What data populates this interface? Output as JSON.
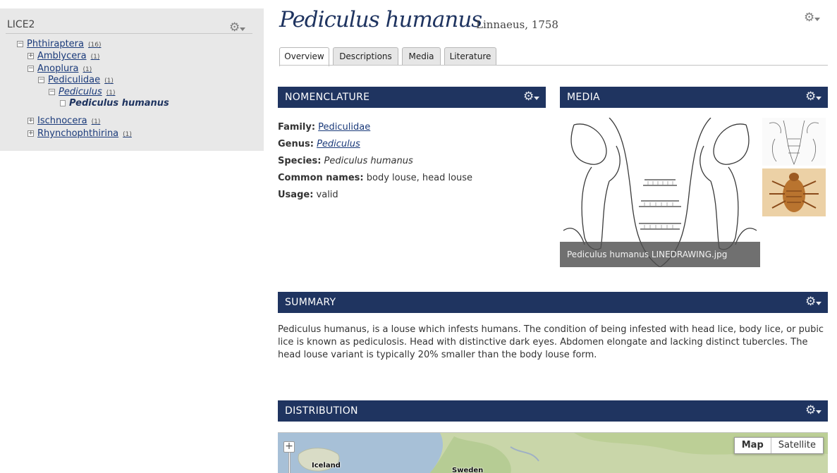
{
  "tree": {
    "title": "LICE2",
    "nodes": [
      {
        "label": "Phthiraptera",
        "count": "(16)",
        "toggle": "−"
      },
      {
        "label": "Amblycera",
        "count": "(1)",
        "toggle": "+"
      },
      {
        "label": "Anoplura",
        "count": "(1)",
        "toggle": "−"
      },
      {
        "label": "Pediculidae",
        "count": "(1)",
        "toggle": "−"
      },
      {
        "label": "Pediculus",
        "count": "(1)",
        "toggle": "−"
      },
      {
        "label": "Pediculus humanus",
        "count": ""
      },
      {
        "label": "Ischnocera",
        "count": "(1)",
        "toggle": "+"
      },
      {
        "label": "Rhynchophthirina",
        "count": "(1)",
        "toggle": "+"
      }
    ]
  },
  "header": {
    "title": "Pediculus humanus",
    "authority": "Linnaeus, 1758"
  },
  "tabs": [
    "Overview",
    "Descriptions",
    "Media",
    "Literature"
  ],
  "nomenclature": {
    "heading": "NOMENCLATURE",
    "family_label": "Family:",
    "family_value": "Pediculidae",
    "genus_label": "Genus:",
    "genus_value": "Pediculus",
    "species_label": "Species:",
    "species_value": "Pediculus humanus",
    "common_label": "Common names:",
    "common_value": "body louse, head louse",
    "usage_label": "Usage:",
    "usage_value": "valid"
  },
  "media": {
    "heading": "MEDIA",
    "caption": "Pediculus humanus LINEDRAWING.jpg"
  },
  "summary": {
    "heading": "SUMMARY",
    "text": "Pediculus humanus, is a louse which infests humans. The condition of being infested with head lice, body lice, or pubic lice is known as pediculosis. Head with distinctive dark eyes. Abdomen elongate and lacking distinct tubercles. The head louse variant is typically 20% smaller than the body louse form."
  },
  "distribution": {
    "heading": "DISTRIBUTION",
    "map_button": "Map",
    "satellite_button": "Satellite",
    "labels": [
      "Iceland",
      "Sweden"
    ]
  },
  "icons": {
    "gear": "gear-icon",
    "zoom": "zoom-in-icon",
    "toggle": "tree-toggle-icon"
  },
  "colors": {
    "section_header": "#1f3460",
    "link": "#1a3a7a",
    "tree_background": "#e8e8e8"
  }
}
